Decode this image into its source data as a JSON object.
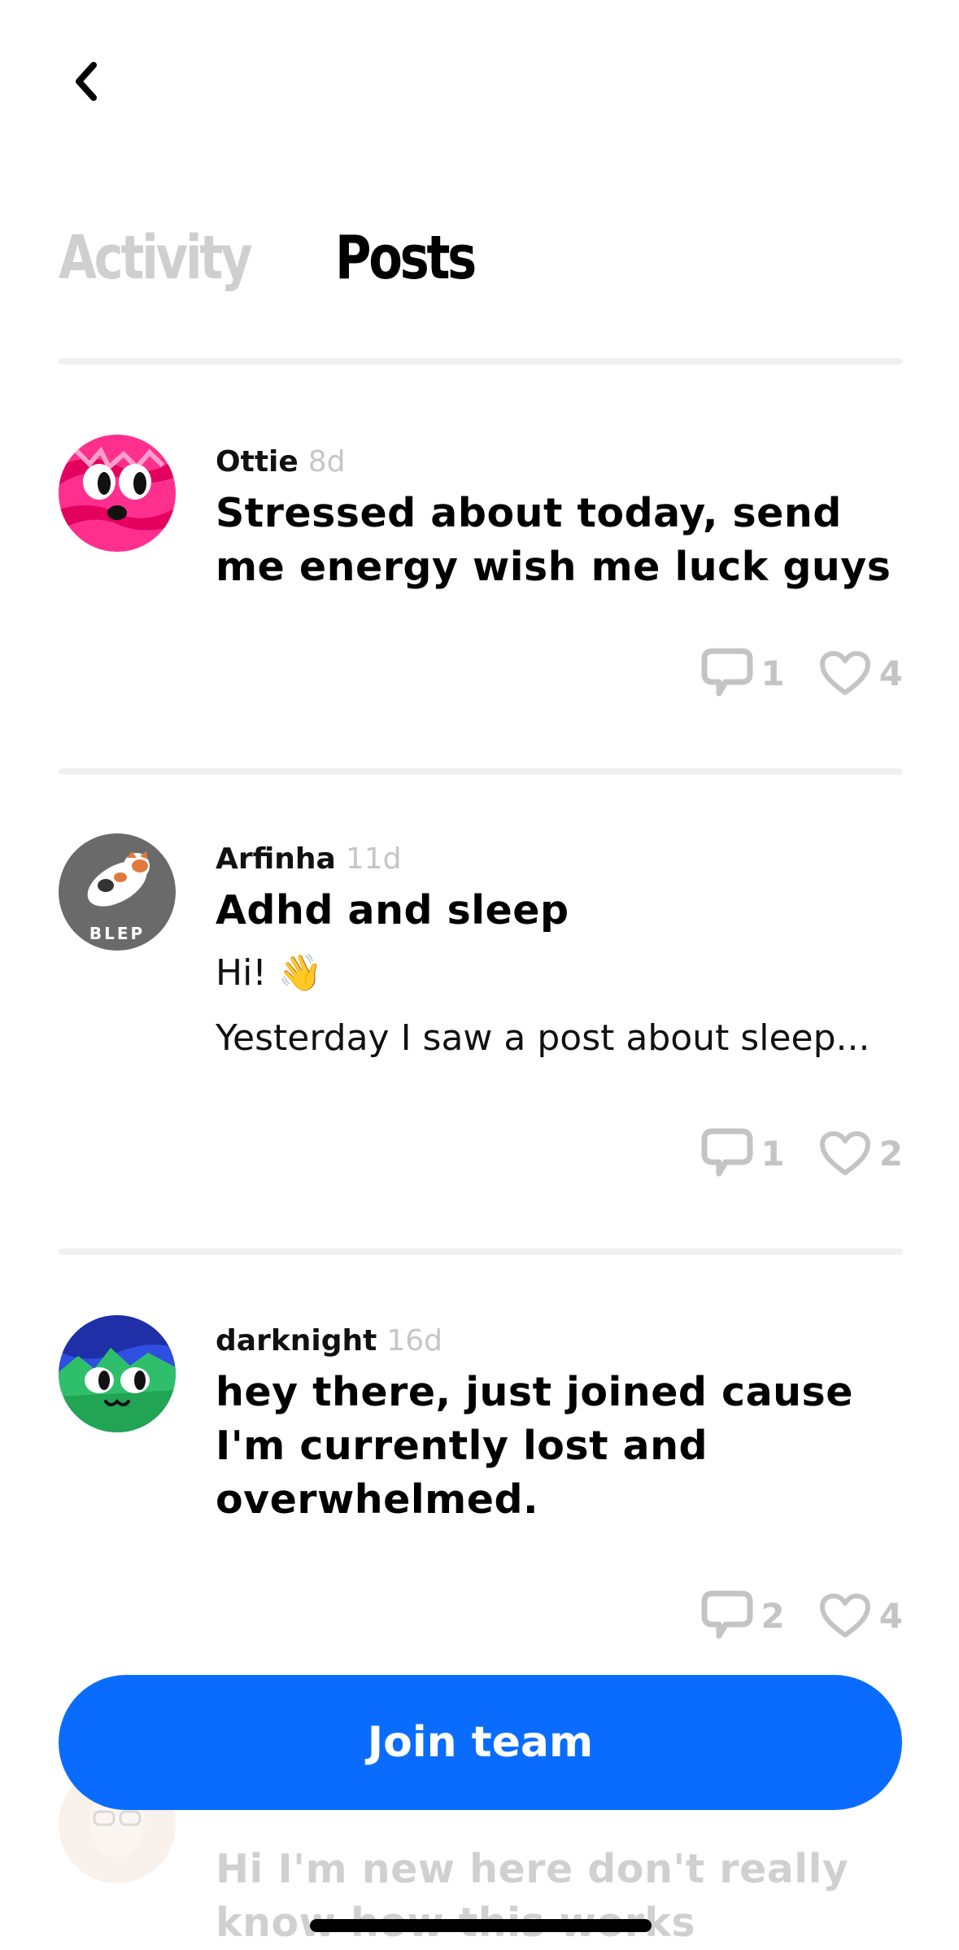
{
  "nav": {
    "back_icon": "chevron-left-icon"
  },
  "tabs": [
    {
      "label": "Activity",
      "active": false
    },
    {
      "label": "Posts",
      "active": true
    }
  ],
  "posts": [
    {
      "author": "Ottie",
      "age": "8d",
      "title": "Stressed about today, send me energy wish me luck guys",
      "excerpt_lines": [],
      "comments": "1",
      "likes": "4"
    },
    {
      "author": "Arfinha",
      "age": "11d",
      "title": "Adhd and sleep",
      "excerpt_lines": [
        "Hi! 👋",
        "Yesterday I saw a post about sleep..."
      ],
      "comments": "1",
      "likes": "2"
    },
    {
      "author": "darknight",
      "age": "16d",
      "title": "hey there, just joined cause I'm currently lost and overwhelmed.",
      "excerpt_lines": [],
      "comments": "2",
      "likes": "4"
    },
    {
      "author": "",
      "age": "",
      "title": "Hi I'm new here don't really know how this works",
      "excerpt_lines": [],
      "comments": "",
      "likes": ""
    }
  ],
  "join_button": {
    "label": "Join team",
    "color": "#0a6cff"
  },
  "colors": {
    "muted": "#c4c4c4",
    "divider": "#f0f0f0"
  }
}
